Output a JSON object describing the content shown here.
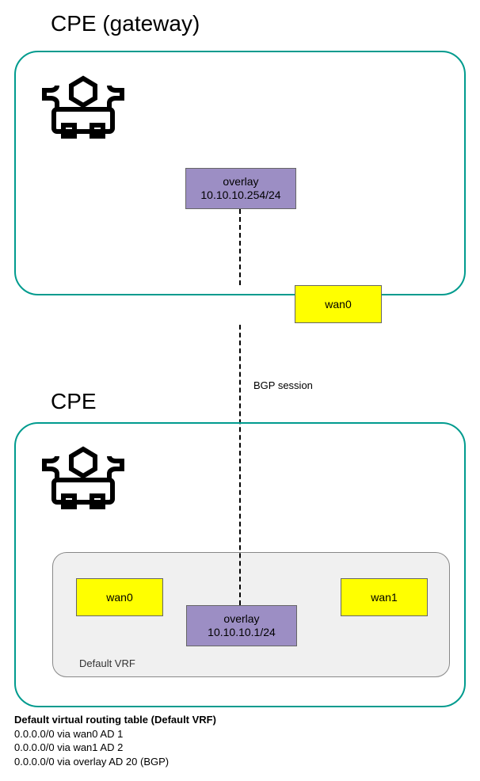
{
  "titles": {
    "gateway": "CPE (gateway)",
    "cpe": "CPE"
  },
  "overlay_top": {
    "label": "overlay",
    "cidr": "10.10.10.254/24"
  },
  "overlay_bottom": {
    "label": "overlay",
    "cidr": "10.10.10.1/24"
  },
  "wan": {
    "wan0_top": "wan0",
    "wan0_bot": "wan0",
    "wan1_bot": "wan1"
  },
  "bgp_label": "BGP session",
  "vrf_label": "Default VRF",
  "routing": {
    "title": "Default virtual routing table (Default VRF)",
    "entries": [
      "0.0.0.0/0 via wan0 AD 1",
      "0.0.0.0/0 via wan1 AD 2",
      "0.0.0.0/0 via overlay AD 20 (BGP)"
    ]
  }
}
